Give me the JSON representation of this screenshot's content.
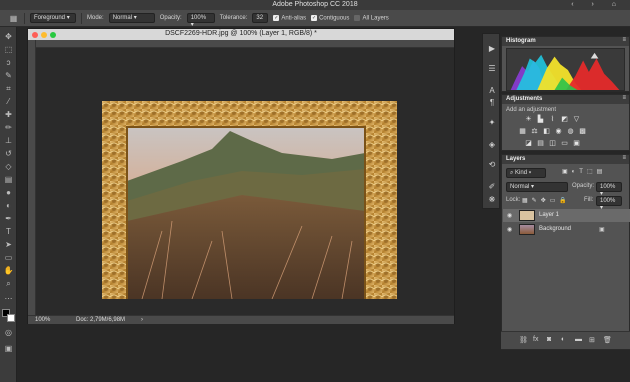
{
  "app": {
    "title": "Adobe Photoshop CC 2018",
    "window_controls": "‹ ›  ⌂"
  },
  "options": {
    "tool_preset": "Foreground",
    "mode_label": "Mode:",
    "mode_value": "Normal",
    "opacity_label": "Opacity:",
    "opacity_value": "100%",
    "tolerance_label": "Tolerance:",
    "tolerance_value": "32",
    "antialias": "Anti-alias",
    "contiguous": "Contiguous",
    "all_layers": "All Layers"
  },
  "document": {
    "title": "DSCF2269-HDR.jpg @ 100% (Layer 1, RGB/8) *",
    "zoom": "100%",
    "doc_size": "Doc: 2,79M/6,98M"
  },
  "panels": {
    "histogram": {
      "title": "Histogram"
    },
    "adjustments": {
      "title": "Adjustments",
      "subtitle": "Add an adjustment"
    },
    "layers": {
      "title": "Layers",
      "kind": "Kind",
      "blend_mode": "Normal",
      "opacity_label": "Opacity:",
      "opacity_value": "100%",
      "lock_label": "Lock:",
      "fill_label": "Fill:",
      "fill_value": "100%",
      "items": [
        {
          "name": "Layer 1",
          "selected": true
        },
        {
          "name": "Background",
          "selected": false
        }
      ]
    }
  },
  "colors": {
    "accent_red": "#fe5f57",
    "accent_yellow": "#febc2e",
    "accent_green": "#28c840"
  }
}
